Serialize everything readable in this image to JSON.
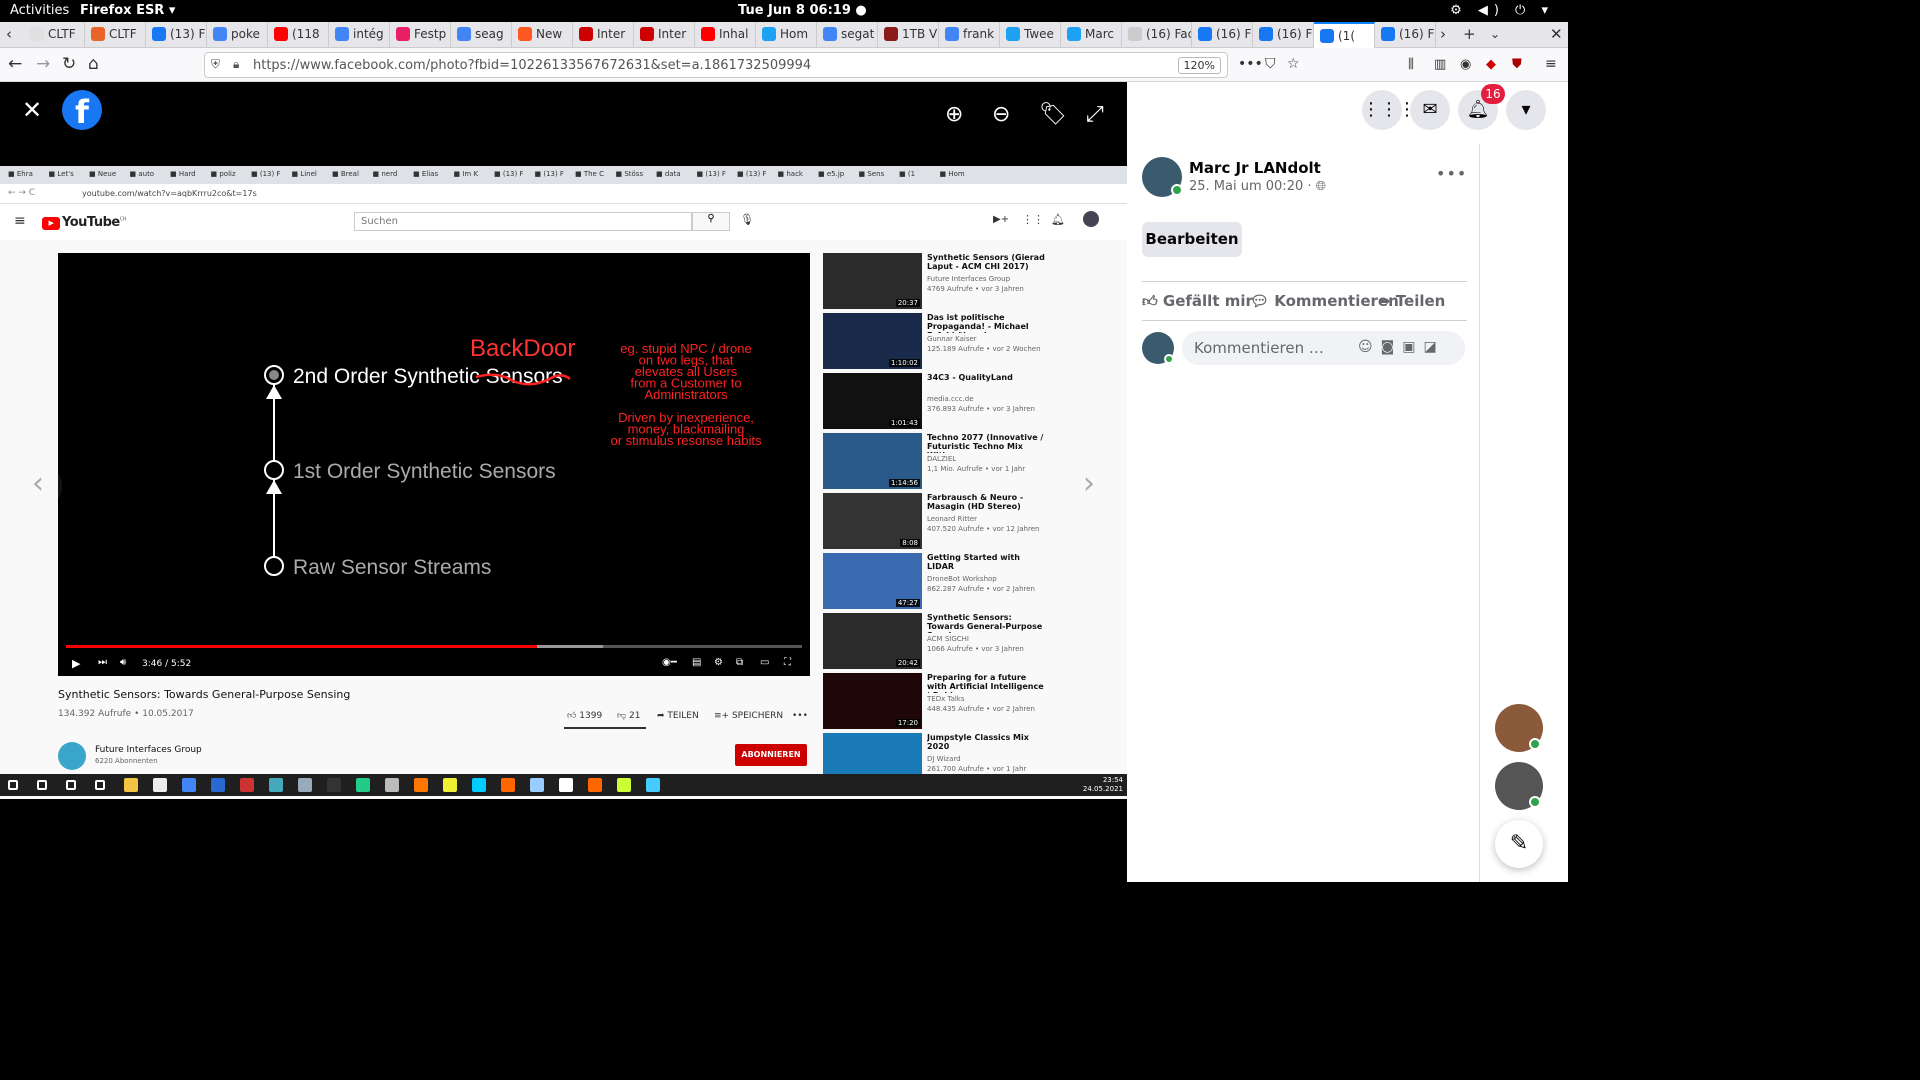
{
  "gnome": {
    "activities": "Activities",
    "app": "Firefox ESR ▾",
    "clock": "Tue Jun 8  06:19 ●"
  },
  "browser": {
    "tabs": [
      {
        "label": "CLTF",
        "color": "#e0e0e0"
      },
      {
        "label": "CLTF",
        "color": "#e8642b"
      },
      {
        "label": "(13) F",
        "color": "#1877f2"
      },
      {
        "label": "poke",
        "color": "#4285f4"
      },
      {
        "label": "(118",
        "color": "#ff0000"
      },
      {
        "label": "intég",
        "color": "#4285f4"
      },
      {
        "label": "Festp",
        "color": "#e91e63"
      },
      {
        "label": "seag",
        "color": "#4285f4"
      },
      {
        "label": "New",
        "color": "#ff5722"
      },
      {
        "label": "Inter",
        "color": "#cc0000"
      },
      {
        "label": "Inter",
        "color": "#cc0000"
      },
      {
        "label": "Inhal",
        "color": "#ff0000"
      },
      {
        "label": "Hom",
        "color": "#1da1f2"
      },
      {
        "label": "segat",
        "color": "#4285f4"
      },
      {
        "label": "1TB V",
        "color": "#8b1a1a"
      },
      {
        "label": "frank",
        "color": "#4285f4"
      },
      {
        "label": "Twee",
        "color": "#1da1f2"
      },
      {
        "label": "Marc",
        "color": "#1da1f2"
      },
      {
        "label": "(16) Face",
        "color": "#cccccc"
      },
      {
        "label": "(16) F",
        "color": "#1877f2"
      },
      {
        "label": "(16) F",
        "color": "#1877f2"
      },
      {
        "label": "(1(",
        "color": "#1877f2"
      },
      {
        "label": "(16) F",
        "color": "#1877f2"
      }
    ],
    "url": "https://www.facebook.com/photo?fbid=10226133567672631&set=a.1861732509994",
    "zoom": "120%"
  },
  "inner": {
    "tabs": [
      "Ehra",
      "Let's",
      "Neue",
      "auto",
      "Hard",
      "poliz",
      "(13) F",
      "Linel",
      "Breal",
      "nerd",
      "Elias",
      "Im K",
      "(13) F",
      "(13) F",
      "The C",
      "Stöss",
      "data",
      "(13) F",
      "(13) F",
      "hack",
      "e5.jp",
      "Sens",
      "(1",
      "Hom"
    ],
    "url": "youtube.com/watch?v=aqbKrrru2co&t=17s",
    "search_placeholder": "Suchen",
    "logo": "YouTube",
    "logo_region": "CH",
    "video": {
      "slide_lines": [
        {
          "label": "2nd Order Synthetic Sensors",
          "level": "top"
        },
        {
          "label": "1st Order Synthetic Sensors",
          "level": "middle"
        },
        {
          "label": "Raw Sensor Streams",
          "level": "bottom"
        }
      ],
      "annotation_title": "BackDoor",
      "annotation_text_1": [
        "eg. stupid NPC / drone",
        "on two legs, that",
        "elevates all Users",
        "from a Customer to",
        "Administrators"
      ],
      "annotation_text_2": [
        "Driven by inexperience,",
        "money, blackmailing",
        "or stimulus resonse habits"
      ],
      "time": "3:46 / 5:52",
      "progress": 0.64,
      "buffered": 0.73
    },
    "title": "Synthetic Sensors: Towards General-Purpose Sensing",
    "meta": "134.392 Aufrufe • 10.05.2017",
    "likes": "1399",
    "dislikes": "21",
    "share": "TEILEN",
    "save": "SPEICHERN",
    "channel": "Future Interfaces Group",
    "subs": "6220 Abonnenten",
    "subscribe": "ABONNIEREN",
    "recs": [
      {
        "title": "Synthetic Sensors (Gierad Laput - ACM CHI 2017)",
        "channel": "Future Interfaces Group",
        "views": "4769 Aufrufe • vor 3 Jahren",
        "duration": "20:37",
        "thumb": "#2b2b2b"
      },
      {
        "title": "Das ist politische Propaganda! - Michael Esfeld über den ...",
        "channel": "Gunnar Kaiser",
        "views": "125.189 Aufrufe • vor 2 Wochen",
        "duration": "1:10:02",
        "thumb": "#1a2a4a"
      },
      {
        "title": "34C3 - QualityLand",
        "channel": "media.ccc.de",
        "views": "376.893 Aufrufe • vor 3 Jahren",
        "duration": "1:01:43",
        "thumb": "#111111"
      },
      {
        "title": "Techno 2077 (Innovative / Futuristic Techno Mix With...",
        "channel": "DALZIEL",
        "views": "1,1 Mio. Aufrufe • vor 1 Jahr",
        "duration": "1:14:56",
        "thumb": "#2a5a8a"
      },
      {
        "title": "Farbrausch & Neuro - Masagin (HD Stereo)",
        "channel": "Leonard Ritter",
        "views": "407.520 Aufrufe • vor 12 Jahren",
        "duration": "8:08",
        "thumb": "#333333"
      },
      {
        "title": "Getting Started with LIDAR",
        "channel": "DroneBot Workshop",
        "views": "862.287 Aufrufe • vor 2 Jahren",
        "duration": "47:27",
        "thumb": "#3a6ab0"
      },
      {
        "title": "Synthetic Sensors: Towards General-Purpose Sensing",
        "channel": "ACM SIGCHI",
        "views": "1066 Aufrufe • vor 3 Jahren",
        "duration": "20:42",
        "thumb": "#2b2b2b"
      },
      {
        "title": "Preparing for a future with Artificial Intelligence | Robin...",
        "channel": "TEDx Talks",
        "views": "448.435 Aufrufe • vor 2 Jahren",
        "duration": "17:20",
        "thumb": "#200808"
      },
      {
        "title": "Jumpstyle Classics Mix 2020",
        "channel": "DJ Wizard",
        "views": "261.700 Aufrufe • vor 1 Jahr",
        "duration": "",
        "thumb": "#1a7ab8"
      }
    ],
    "taskbar_clock": [
      "23:54",
      "24.05.2021"
    ]
  },
  "fb": {
    "notif_count": "16",
    "author": "Marc Jr LANdolt",
    "date": "25. Mai um 00:20 · ",
    "edit": "Bearbeiten",
    "like": "Gefällt mir",
    "comment": "Kommentieren",
    "share": "Teilen",
    "comment_placeholder": "Kommentieren …",
    "accent": "#1877f2"
  }
}
